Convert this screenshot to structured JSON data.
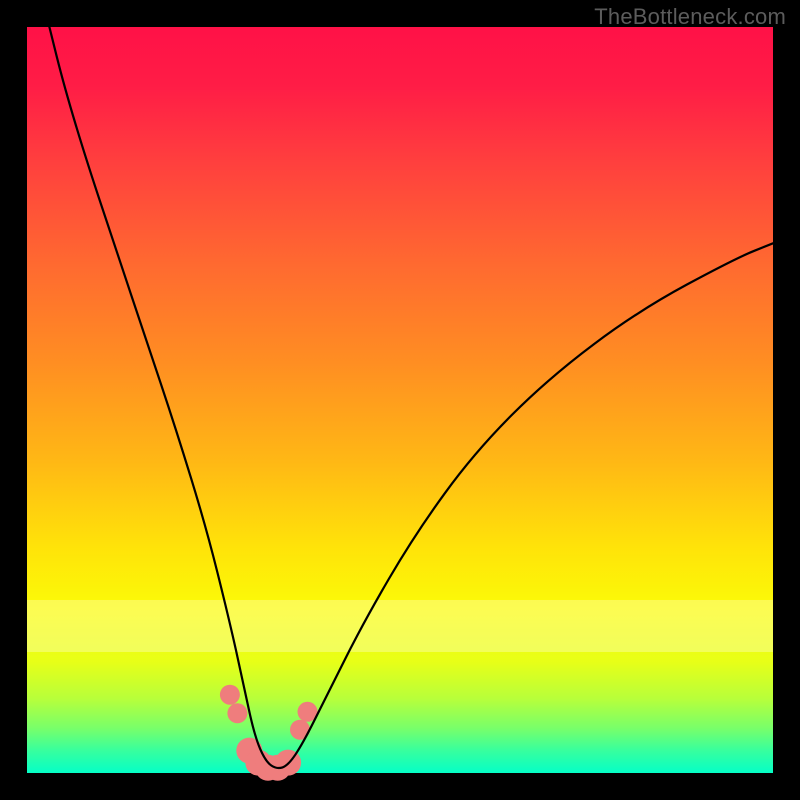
{
  "watermark": "TheBottleneck.com",
  "chart_data": {
    "type": "line",
    "title": "",
    "xlabel": "",
    "ylabel": "",
    "xlim": [
      0,
      100
    ],
    "ylim": [
      0,
      100
    ],
    "grid": false,
    "series": [
      {
        "name": "bottleneck-curve",
        "x": [
          3,
          5,
          8,
          12,
          16,
          20,
          24,
          27,
          29,
          30.5,
          32,
          33.5,
          35,
          37,
          40,
          45,
          52,
          60,
          70,
          82,
          95,
          100
        ],
        "values": [
          100,
          92,
          82,
          70,
          58,
          46,
          33,
          21,
          12,
          5,
          1.5,
          0.5,
          1,
          4,
          10,
          20,
          32,
          43,
          53,
          62,
          69,
          71
        ]
      }
    ],
    "markers": {
      "name": "highlight-points",
      "color": "#ef7d7d",
      "x": [
        27.2,
        28.2,
        29.8,
        31.0,
        32.3,
        33.6,
        35.0,
        36.6,
        37.6
      ],
      "values": [
        10.5,
        8.0,
        3.0,
        1.4,
        0.7,
        0.7,
        1.4,
        5.8,
        8.2
      ],
      "radius": [
        10,
        10,
        13,
        13,
        13,
        13,
        13,
        10,
        10
      ]
    },
    "background_gradient": {
      "top": "#ff1147",
      "upper_mid": "#ff8e22",
      "mid": "#ffe409",
      "lower_mid": "#b8ff3a",
      "bottom": "#05ffc7"
    }
  }
}
